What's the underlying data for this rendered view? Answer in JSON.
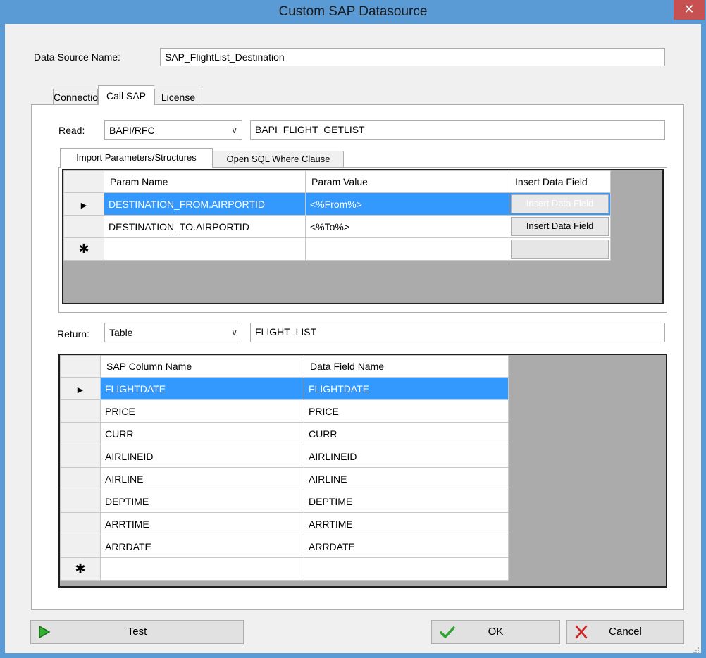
{
  "window": {
    "title": "Custom SAP Datasource",
    "close_glyph": "✕"
  },
  "datasource": {
    "label": "Data Source Name:",
    "value": "SAP_FlightList_Destination"
  },
  "tabs": [
    {
      "label": "Connection"
    },
    {
      "label": "Call SAP"
    },
    {
      "label": "License"
    }
  ],
  "read": {
    "label": "Read:",
    "type": "BAPI/RFC",
    "function": "BAPI_FLIGHT_GETLIST"
  },
  "subtabs": [
    {
      "label": "Import Parameters/Structures"
    },
    {
      "label": "Open SQL Where Clause"
    }
  ],
  "params": {
    "headers": [
      "Param Name",
      "Param Value",
      "Insert Data Field"
    ],
    "rows": [
      {
        "name": "DESTINATION_FROM.AIRPORTID",
        "value": "<%From%>",
        "button": "Insert Data Field"
      },
      {
        "name": "DESTINATION_TO.AIRPORTID",
        "value": "<%To%>",
        "button": "Insert Data Field"
      }
    ]
  },
  "return": {
    "label": "Return:",
    "type": "Table",
    "name": "FLIGHT_LIST"
  },
  "columns": {
    "headers": [
      "SAP Column Name",
      "Data Field Name"
    ],
    "rows": [
      {
        "sap": "FLIGHTDATE",
        "field": "FLIGHTDATE"
      },
      {
        "sap": "PRICE",
        "field": "PRICE"
      },
      {
        "sap": "CURR",
        "field": "CURR"
      },
      {
        "sap": "AIRLINEID",
        "field": "AIRLINEID"
      },
      {
        "sap": "AIRLINE",
        "field": "AIRLINE"
      },
      {
        "sap": "DEPTIME",
        "field": "DEPTIME"
      },
      {
        "sap": "ARRTIME",
        "field": "ARRTIME"
      },
      {
        "sap": "ARRDATE",
        "field": "ARRDATE"
      }
    ]
  },
  "row_marks": {
    "current": "▶",
    "new": "✱"
  },
  "buttons": {
    "test": "Test",
    "ok": "OK",
    "cancel": "Cancel"
  },
  "colors": {
    "title_bar": "#5b9bd5",
    "selection": "#3399ff",
    "close": "#c75050"
  }
}
